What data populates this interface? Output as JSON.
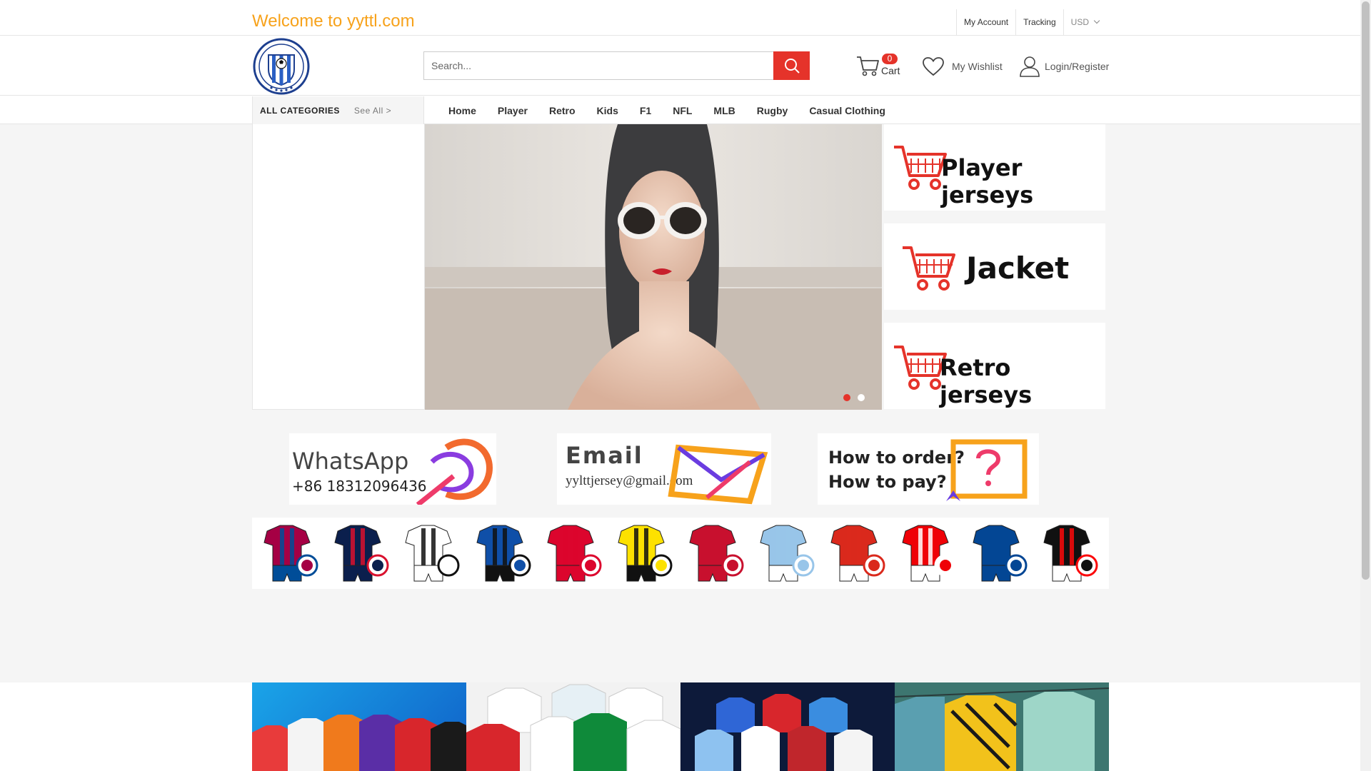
{
  "topbar": {
    "welcome": "Welcome to yyttl.com",
    "links": [
      "My Account",
      "Tracking"
    ],
    "currency": "USD"
  },
  "header": {
    "search_placeholder": "Search...",
    "cart_count": "0",
    "cart_label": "Cart",
    "wishlist_label": "My Wishlist",
    "login_label": "Login/Register"
  },
  "nav": {
    "all_categories": "ALL CATEGORIES",
    "see_all": "See All >",
    "items": [
      "Home",
      "Player",
      "Retro",
      "Kids",
      "F1",
      "NFL",
      "MLB",
      "Rugby",
      "Casual Clothing"
    ]
  },
  "promos": {
    "player": "Player jerseys",
    "jacket": "Jacket",
    "retro": "Retro jerseys"
  },
  "contact": {
    "whatsapp_title": "WhatsApp",
    "whatsapp_number": "+86 18312096436",
    "email_title": "Email",
    "email_address": "yylttjersey@gmail.com",
    "order_line1": "How to order?",
    "order_line2": "How to pay?"
  },
  "colors": {
    "accent": "#e5332a",
    "welcome": "#f7a21b"
  },
  "team_kits": [
    {
      "name": "barcelona",
      "shirt": "#a50044",
      "stripe": "#004d98",
      "shorts": "#004d98"
    },
    {
      "name": "psg",
      "shirt": "#0b1f4d",
      "stripe": "#d9112e",
      "shorts": "#0b1f4d"
    },
    {
      "name": "juventus",
      "shirt": "#ffffff",
      "stripe": "#111111",
      "shorts": "#ffffff"
    },
    {
      "name": "inter",
      "shirt": "#0f4fa8",
      "stripe": "#111111",
      "shorts": "#111111"
    },
    {
      "name": "bayern",
      "shirt": "#dc052d",
      "stripe": "#dc052d",
      "shorts": "#dc052d"
    },
    {
      "name": "dortmund",
      "shirt": "#fde100",
      "stripe": "#111111",
      "shorts": "#111111"
    },
    {
      "name": "liverpool",
      "shirt": "#c8102e",
      "stripe": "#c8102e",
      "shorts": "#c8102e"
    },
    {
      "name": "man-city",
      "shirt": "#98c5e9",
      "stripe": "#98c5e9",
      "shorts": "#ffffff"
    },
    {
      "name": "man-united",
      "shirt": "#da291c",
      "stripe": "#da291c",
      "shorts": "#ffffff"
    },
    {
      "name": "arsenal",
      "shirt": "#ef0107",
      "stripe": "#ffffff",
      "shorts": "#ffffff"
    },
    {
      "name": "chelsea",
      "shirt": "#034694",
      "stripe": "#034694",
      "shorts": "#034694"
    },
    {
      "name": "ac-milan",
      "shirt": "#111111",
      "stripe": "#fb090b",
      "shorts": "#ffffff"
    }
  ]
}
